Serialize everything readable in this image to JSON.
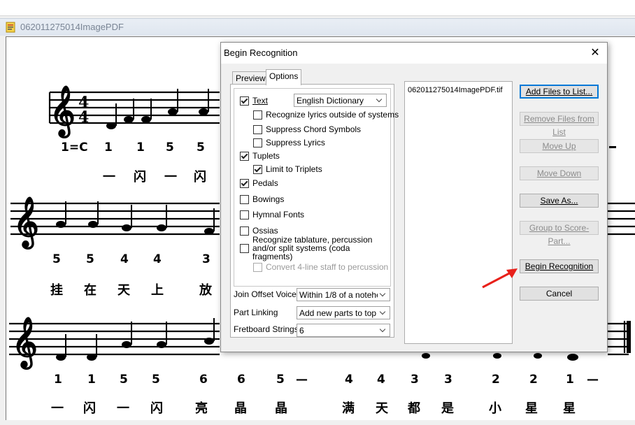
{
  "document": {
    "title": "062011275014ImagePDF",
    "sheet": {
      "row1_jianpu": [
        "1=C",
        "1",
        "1",
        "5",
        "5"
      ],
      "row1_lyrics": [
        "一",
        "闪",
        "一",
        "闪"
      ],
      "row2_jianpu": [
        "5",
        "5",
        "4",
        "4",
        "3"
      ],
      "row2_lyrics": [
        "挂",
        "在",
        "天",
        "上",
        "放"
      ],
      "row3_jianpu": [
        "1",
        "1",
        "5",
        "5",
        "6",
        "6",
        "5",
        "—",
        "4",
        "4",
        "3",
        "3",
        "2",
        "2",
        "1",
        "—"
      ],
      "row3_lyrics": [
        "一",
        "闪",
        "一",
        "闪",
        "亮",
        "晶",
        "晶",
        "满",
        "天",
        "都",
        "是",
        "小",
        "星",
        "星"
      ]
    }
  },
  "dialog": {
    "title": "Begin Recognition",
    "close_label": "✕",
    "tabs": [
      "Preview",
      "Options"
    ],
    "active_tab": "Options",
    "options": {
      "text_label": "Text",
      "text_checked": true,
      "text_dictionary": "English Dictionary",
      "recognize_lyrics_label": "Recognize lyrics outside of systems",
      "suppress_chord_label": "Suppress Chord Symbols",
      "suppress_lyrics_label": "Suppress Lyrics",
      "tuplets_label": "Tuplets",
      "tuplets_checked": true,
      "limit_triplets_label": "Limit to Triplets",
      "limit_triplets_checked": true,
      "pedals_label": "Pedals",
      "pedals_checked": true,
      "bowings_label": "Bowings",
      "hymnal_label": "Hymnal Fonts",
      "ossias_label": "Ossias",
      "tablature_label": "Recognize tablature, percussion and/or split systems (coda fragments)",
      "convert_label": "Convert 4-line staff to percussion",
      "join_offset_label": "Join Offset Voices",
      "join_offset_value": "Within 1/8 of a notehea",
      "part_linking_label": "Part Linking",
      "part_linking_value": "Add new parts to top",
      "fretboard_label": "Fretboard Strings",
      "fretboard_value": "6"
    },
    "file_list": [
      "062011275014ImagePDF.tif"
    ],
    "buttons": {
      "add_files": "Add Files to List...",
      "remove_files": "Remove Files from List",
      "move_up": "Move Up",
      "move_down": "Move Down",
      "save_as": "Save As...",
      "group_score": "Group to Score-Part...",
      "begin_recognition": "Begin Recognition",
      "cancel": "Cancel"
    },
    "annotation_color": "#e8201a"
  }
}
